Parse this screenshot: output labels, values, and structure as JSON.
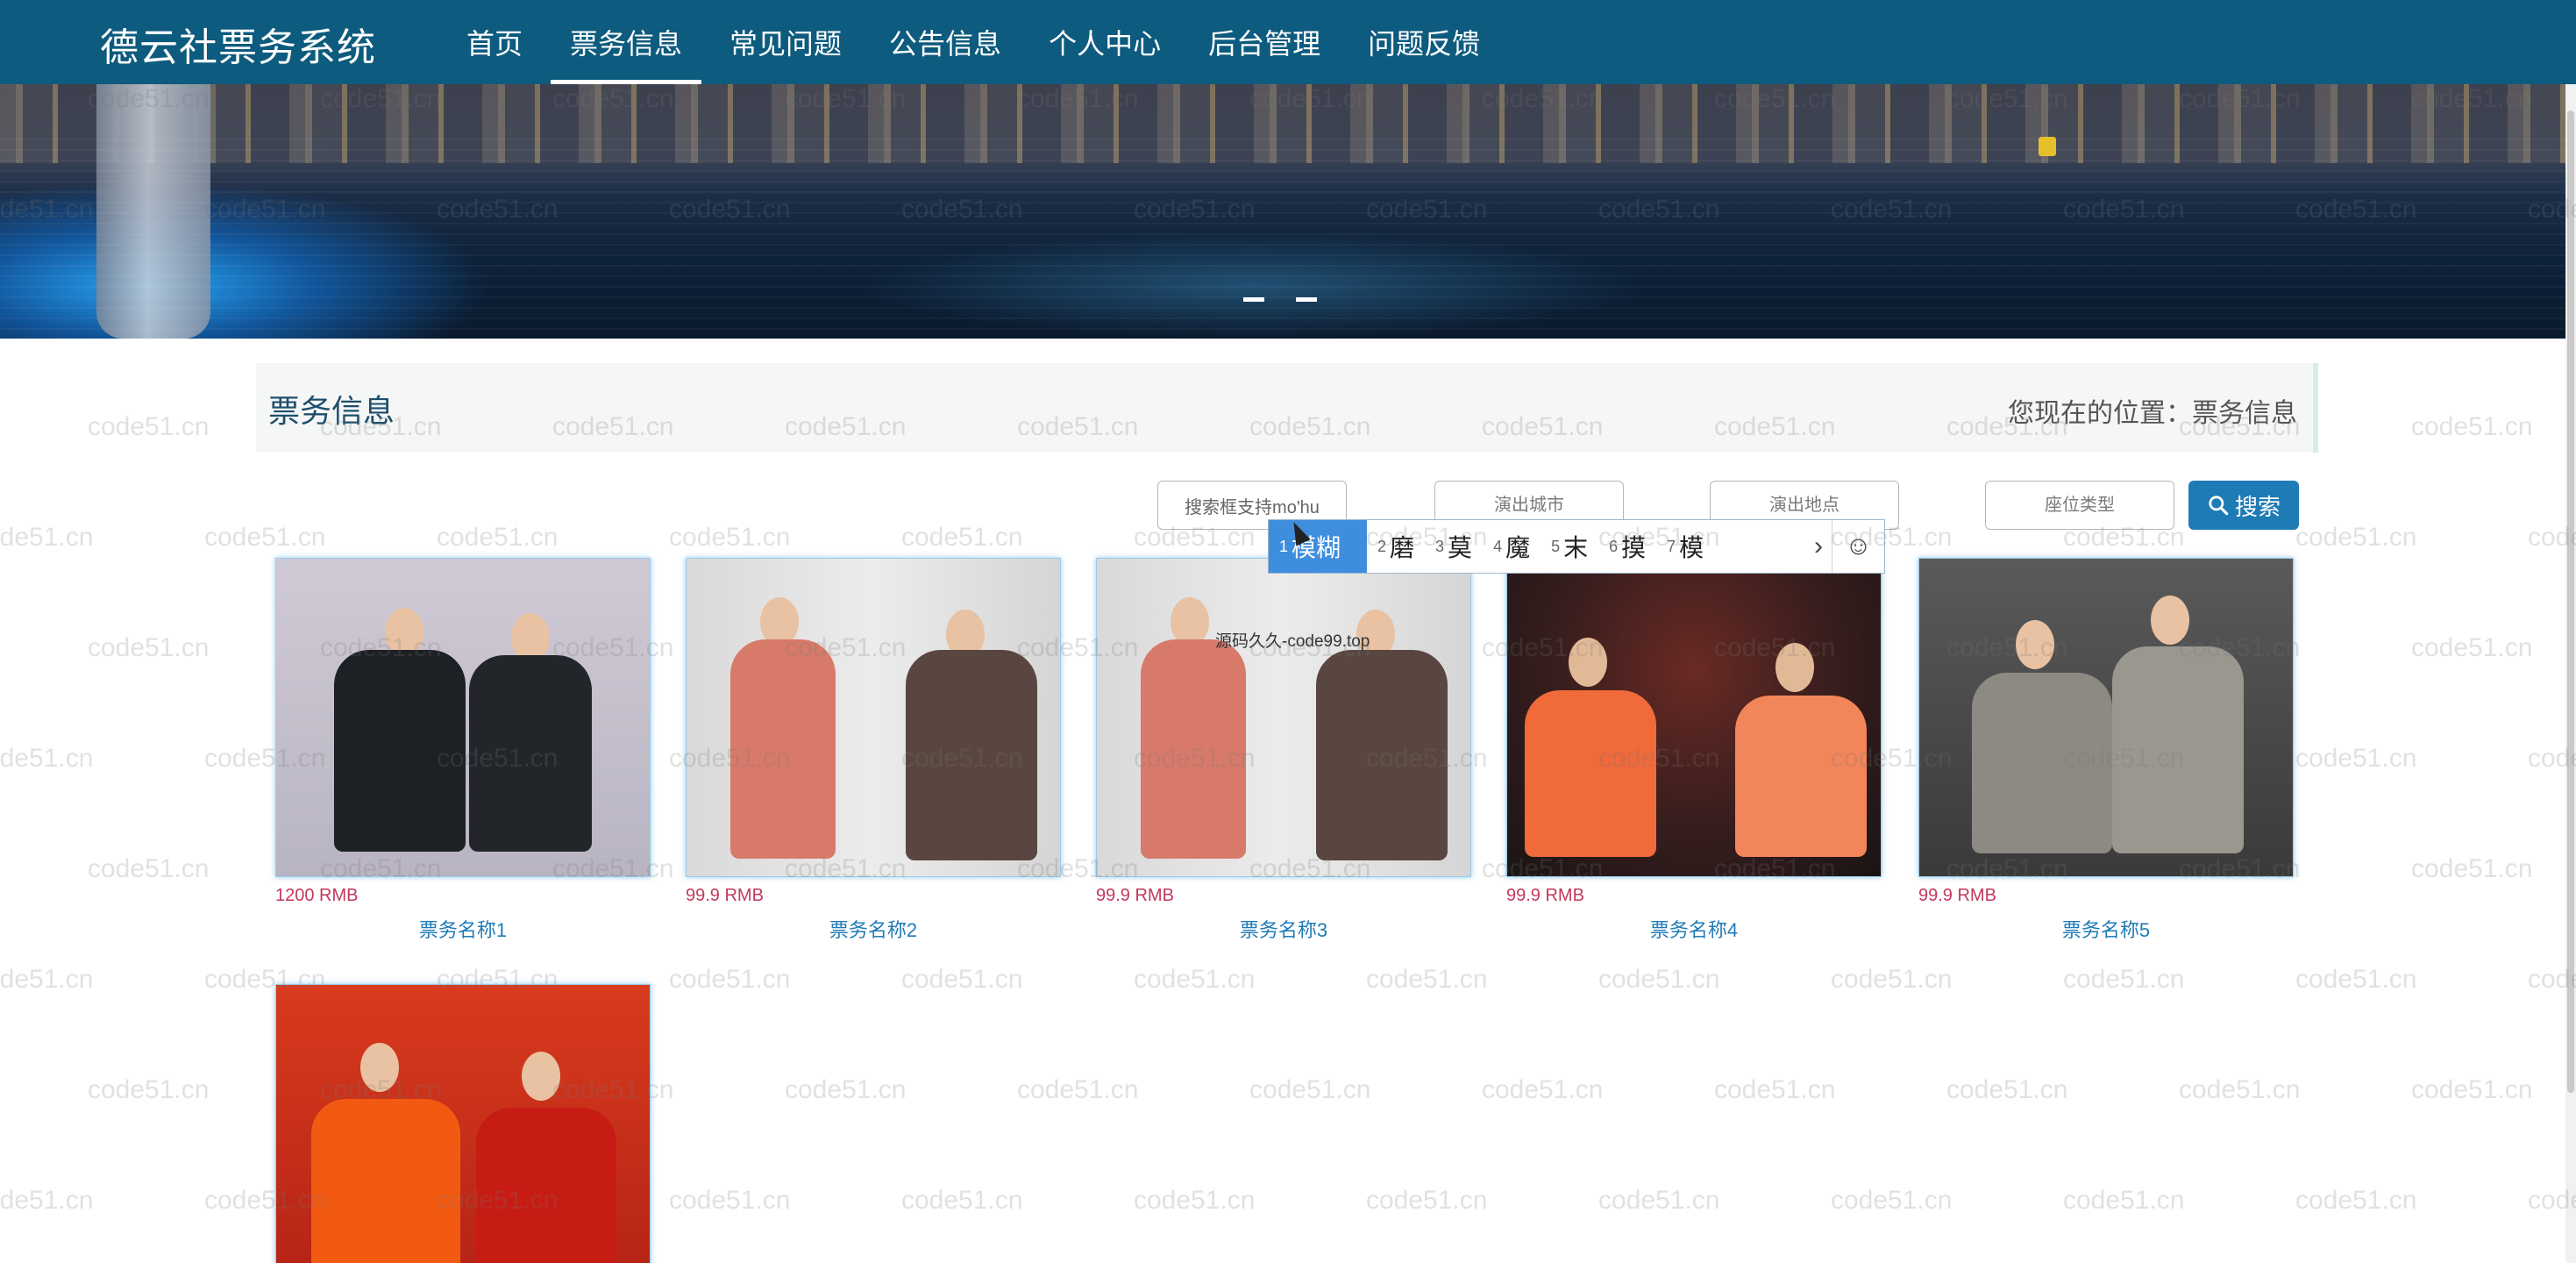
{
  "nav": {
    "brand": "德云社票务系统",
    "items": [
      {
        "label": "首页",
        "active": false
      },
      {
        "label": "票务信息",
        "active": true
      },
      {
        "label": "常见问题",
        "active": false
      },
      {
        "label": "公告信息",
        "active": false
      },
      {
        "label": "个人中心",
        "active": false
      },
      {
        "label": "后台管理",
        "active": false
      },
      {
        "label": "问题反馈",
        "active": false
      }
    ]
  },
  "page": {
    "title": "票务信息",
    "breadcrumb_prefix": "您现在的位置：",
    "breadcrumb_current": "票务信息"
  },
  "search": {
    "keyword_value": "搜索框支持mo'hu",
    "city_placeholder": "演出城市",
    "place_placeholder": "演出地点",
    "seat_placeholder": "座位类型",
    "button_label": "搜索"
  },
  "ime": {
    "candidates": [
      {
        "num": "1",
        "text": "模糊"
      },
      {
        "num": "2",
        "text": "磨"
      },
      {
        "num": "3",
        "text": "莫"
      },
      {
        "num": "4",
        "text": "魔"
      },
      {
        "num": "5",
        "text": "末"
      },
      {
        "num": "6",
        "text": "摸"
      },
      {
        "num": "7",
        "text": "模"
      }
    ]
  },
  "tickets": [
    {
      "price": "1200 RMB",
      "name": "票务名称1"
    },
    {
      "price": "99.9 RMB",
      "name": "票务名称2"
    },
    {
      "price": "99.9 RMB",
      "name": "票务名称3"
    },
    {
      "price": "99.9 RMB",
      "name": "票务名称4"
    },
    {
      "price": "99.9 RMB",
      "name": "票务名称5"
    }
  ],
  "watermark": "code51.cn",
  "image_overlay_text": "源码久久-code99.top",
  "colors": {
    "nav": "#0d5b7e",
    "accent": "#1f7bb6",
    "price": "#c2385d"
  }
}
